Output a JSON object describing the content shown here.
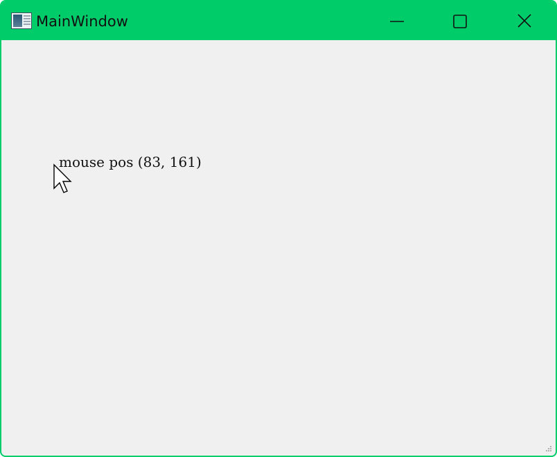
{
  "window": {
    "title": "MainWindow",
    "icon": "window-app-icon",
    "title_bar_color": "#00cc6a",
    "border_color": "#00cc6a",
    "background_color": "#f0f0f0"
  },
  "controls": {
    "minimize_icon": "minimize-icon",
    "maximize_icon": "maximize-icon",
    "close_icon": "close-icon"
  },
  "content": {
    "mouse_label": "mouse pos (83, 161)"
  },
  "cursor": {
    "icon": "arrow-cursor-icon"
  },
  "resize_grip": {
    "icon": "resize-grip-icon"
  }
}
